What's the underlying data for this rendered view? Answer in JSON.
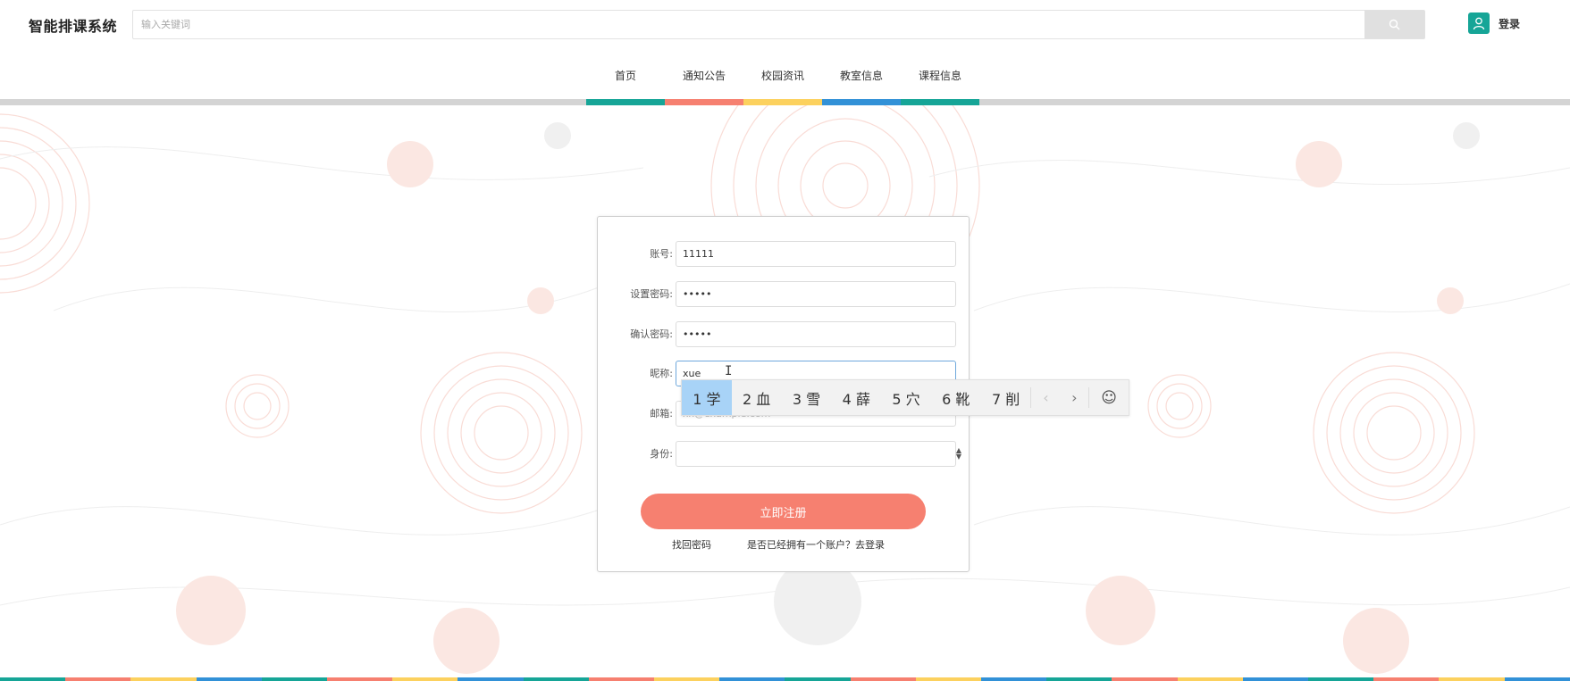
{
  "header": {
    "brand": "智能排课系统",
    "search_placeholder": "输入关键词",
    "login": "登录"
  },
  "nav": {
    "items": [
      "首页",
      "通知公告",
      "校园资讯",
      "教室信息",
      "课程信息"
    ],
    "colors": [
      "#16a597",
      "#f68070",
      "#fcd15e",
      "#3291d7",
      "#16a597"
    ]
  },
  "form": {
    "fields": [
      {
        "label": "账号:",
        "value": "11111"
      },
      {
        "label": "设置密码:",
        "value": "•••••"
      },
      {
        "label": "确认密码:",
        "value": "•••••"
      },
      {
        "label": "昵称:",
        "value": "xue"
      },
      {
        "label": "邮箱:",
        "placeholder": "xx@example.com"
      },
      {
        "label": "身份:",
        "value": ""
      }
    ],
    "submit": "立即注册",
    "forgot": "找回密码",
    "have_account": "是否已经拥有一个账户？去登录"
  },
  "ime": {
    "candidates": [
      "1 学",
      "2 血",
      "3 雪",
      "4 薛",
      "5 穴",
      "6 靴",
      "7 削"
    ],
    "prev": "‹",
    "next": "›",
    "emoji": "☺"
  },
  "colors": {
    "accent_teal": "#16a597",
    "accent_coral": "#f68070",
    "accent_yellow": "#fcd15e",
    "accent_blue": "#3291d7"
  }
}
